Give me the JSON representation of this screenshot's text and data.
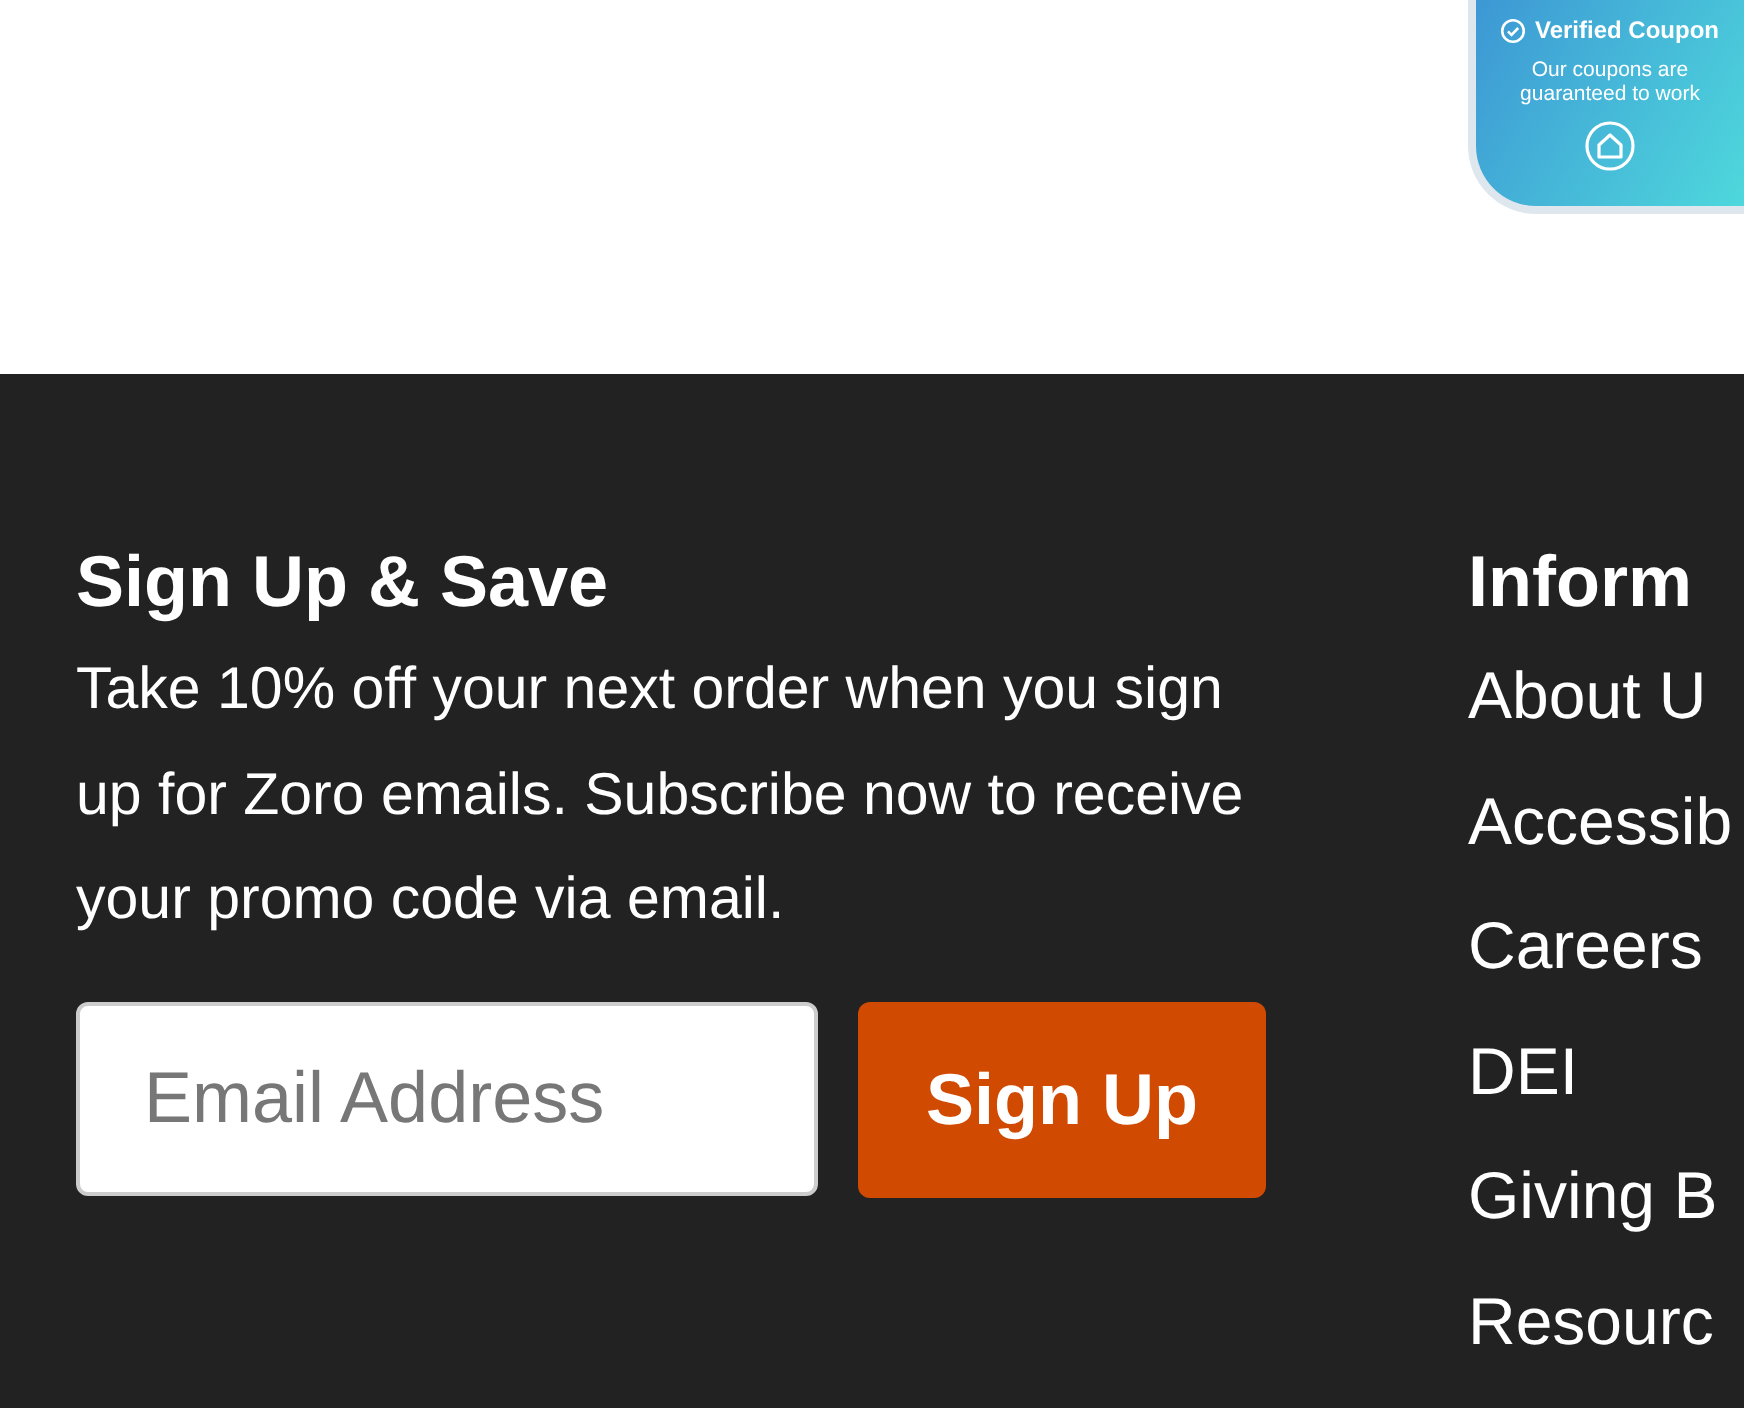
{
  "coupon_badge": {
    "title": "Verified Coupon",
    "text": "Our coupons are guaranteed to work"
  },
  "signup": {
    "heading": "Sign Up & Save",
    "text": "Take 10% off your next order when you sign up for Zoro emails. Subscribe now to receive your promo code via email.",
    "email_placeholder": "Email Address",
    "button": "Sign Up"
  },
  "information": {
    "heading": "Inform",
    "links": [
      "About U",
      "Accessib",
      "Careers",
      "DEI",
      "Giving B",
      "Resourc"
    ]
  }
}
